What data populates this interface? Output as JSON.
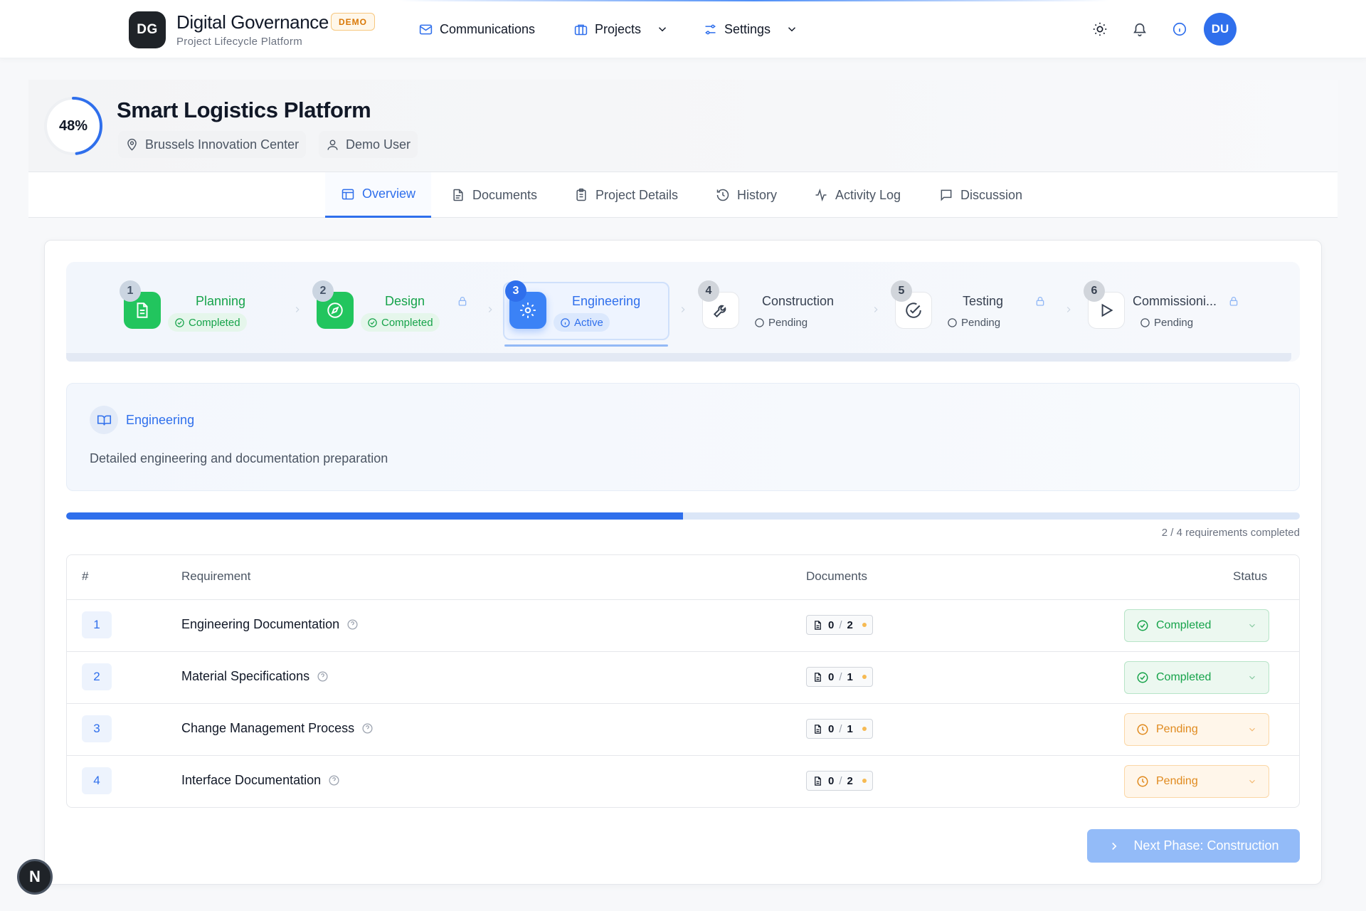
{
  "header": {
    "logo": "DG",
    "title": "Digital Governance",
    "badge": "DEMO",
    "subtitle": "Project Lifecycle Platform",
    "nav": [
      {
        "label": "Communications",
        "icon": "mail-icon"
      },
      {
        "label": "Projects",
        "icon": "briefcase-icon"
      },
      {
        "label": "Settings",
        "icon": "sliders-icon"
      }
    ],
    "avatar": "DU"
  },
  "project": {
    "progress_percent": 48,
    "progress_label": "48%",
    "title": "Smart Logistics Platform",
    "location": "Brussels Innovation Center",
    "user": "Demo User"
  },
  "tabs": [
    {
      "label": "Overview",
      "active": true
    },
    {
      "label": "Documents"
    },
    {
      "label": "Project Details"
    },
    {
      "label": "History"
    },
    {
      "label": "Activity Log"
    },
    {
      "label": "Discussion"
    }
  ],
  "phases": [
    {
      "num": "1",
      "name": "Planning",
      "status": "Completed",
      "state": "completed",
      "locked": false
    },
    {
      "num": "2",
      "name": "Design",
      "status": "Completed",
      "state": "completed",
      "locked": true
    },
    {
      "num": "3",
      "name": "Engineering",
      "status": "Active",
      "state": "active",
      "locked": false
    },
    {
      "num": "4",
      "name": "Construction",
      "status": "Pending",
      "state": "pending",
      "locked": false
    },
    {
      "num": "5",
      "name": "Testing",
      "status": "Pending",
      "state": "pending",
      "locked": true
    },
    {
      "num": "6",
      "name": "Commissioni...",
      "status": "Pending",
      "state": "pending",
      "locked": true
    }
  ],
  "phase_info": {
    "title": "Engineering",
    "description": "Detailed engineering and documentation preparation"
  },
  "requirements_progress": {
    "completed": 2,
    "total": 4,
    "label": "2 / 4 requirements completed"
  },
  "table": {
    "headers": {
      "num": "#",
      "requirement": "Requirement",
      "documents": "Documents",
      "status": "Status"
    },
    "rows": [
      {
        "num": "1",
        "name": "Engineering Documentation",
        "docs_done": "0",
        "docs_sep": "/",
        "docs_total": "2",
        "status": "Completed"
      },
      {
        "num": "2",
        "name": "Material Specifications",
        "docs_done": "0",
        "docs_sep": "/",
        "docs_total": "1",
        "status": "Completed"
      },
      {
        "num": "3",
        "name": "Change Management Process",
        "docs_done": "0",
        "docs_sep": "/",
        "docs_total": "1",
        "status": "Pending"
      },
      {
        "num": "4",
        "name": "Interface Documentation",
        "docs_done": "0",
        "docs_sep": "/",
        "docs_total": "2",
        "status": "Pending"
      }
    ]
  },
  "next_button": "Next Phase: Construction",
  "corner_badge": "N",
  "colors": {
    "accent": "#2f6fec",
    "completed": "#22c55e",
    "pending": "#e08a1e"
  }
}
